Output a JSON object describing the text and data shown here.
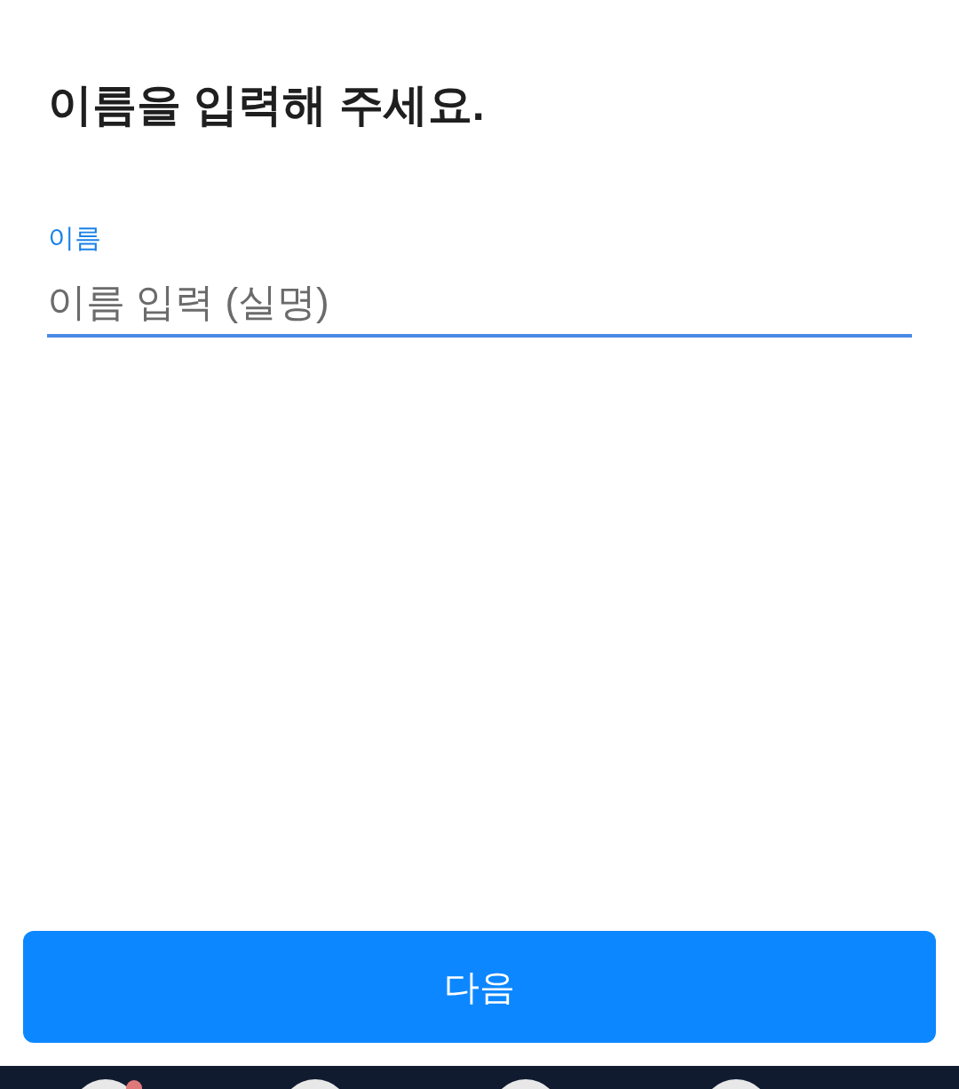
{
  "title": "이름을 입력해 주세요.",
  "name_field": {
    "label": "이름",
    "placeholder": "이름 입력 (실명)",
    "focused": true
  },
  "next_button": {
    "label": "다음"
  }
}
